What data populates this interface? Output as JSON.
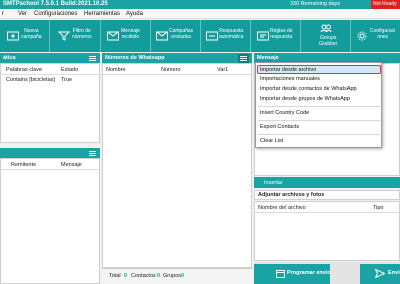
{
  "titlebar": {
    "title": "SMTPschool 7.5.0.1 Build:2021.10.25",
    "days": "336 Remaining days",
    "status": "Not Ready"
  },
  "menu": [
    "r",
    "Ver",
    "Configuraciones",
    "Herramientas",
    "Ayuda"
  ],
  "toolbar": [
    {
      "label": "Nueva\ncampaña",
      "icon": "new-campaign-icon"
    },
    {
      "label": "Filtro de\nnúmeros",
      "icon": "filter-icon"
    },
    {
      "label": "Mensaje\nrecibido",
      "icon": "message-received-icon"
    },
    {
      "label": "Campañas\nenviadas",
      "icon": "sent-campaigns-icon"
    },
    {
      "label": "Respuesta\nautomática",
      "icon": "auto-reply-icon"
    },
    {
      "label": "Reglas de\nrespuesta",
      "icon": "reply-rules-icon"
    },
    {
      "label": "Groups\nGrabber",
      "icon": "groups-grabber-icon"
    },
    {
      "label": "Configuraci\nones",
      "icon": "settings-icon"
    }
  ],
  "left_top": {
    "header": "ática",
    "columns": [
      "Palabras clave",
      "Estado"
    ],
    "rows": [
      {
        "keyword": "Contains [bicicletas]",
        "state": "True"
      }
    ]
  },
  "left_bottom": {
    "columns": [
      "Remitente",
      "Mensaje"
    ]
  },
  "numbers": {
    "header": "Números de Whatsapp",
    "columns": [
      "Nombre",
      "Número",
      "Var1"
    ],
    "footer": {
      "total_label": "Total",
      "contacts_count": "0",
      "contacts_label": "Contactos",
      "groups_count": "0",
      "groups_label": "Grupos",
      "extra_count": "0"
    }
  },
  "message": {
    "header": "Mensaje",
    "insert_label": "Insertar"
  },
  "dropdown": {
    "items": [
      "Importar desde archivo",
      "Importaciones manuales",
      "Importar desde contactos de WhatsApp",
      "Importar desde grupos de WhatsApp",
      "Insert Country Code",
      "Export Contacts",
      "Clear List"
    ]
  },
  "attachments": {
    "header": "Adjuntar archivos y fotos",
    "columns": [
      "Nombre del archivo",
      "Tipo"
    ]
  },
  "actions": {
    "schedule": "Programar envío",
    "send": "Enviar"
  },
  "colors": {
    "teal": "#1aa3a3",
    "toolbar": "#149c9c",
    "not_ready": "#e02020",
    "highlight_border": "#e0303a"
  }
}
